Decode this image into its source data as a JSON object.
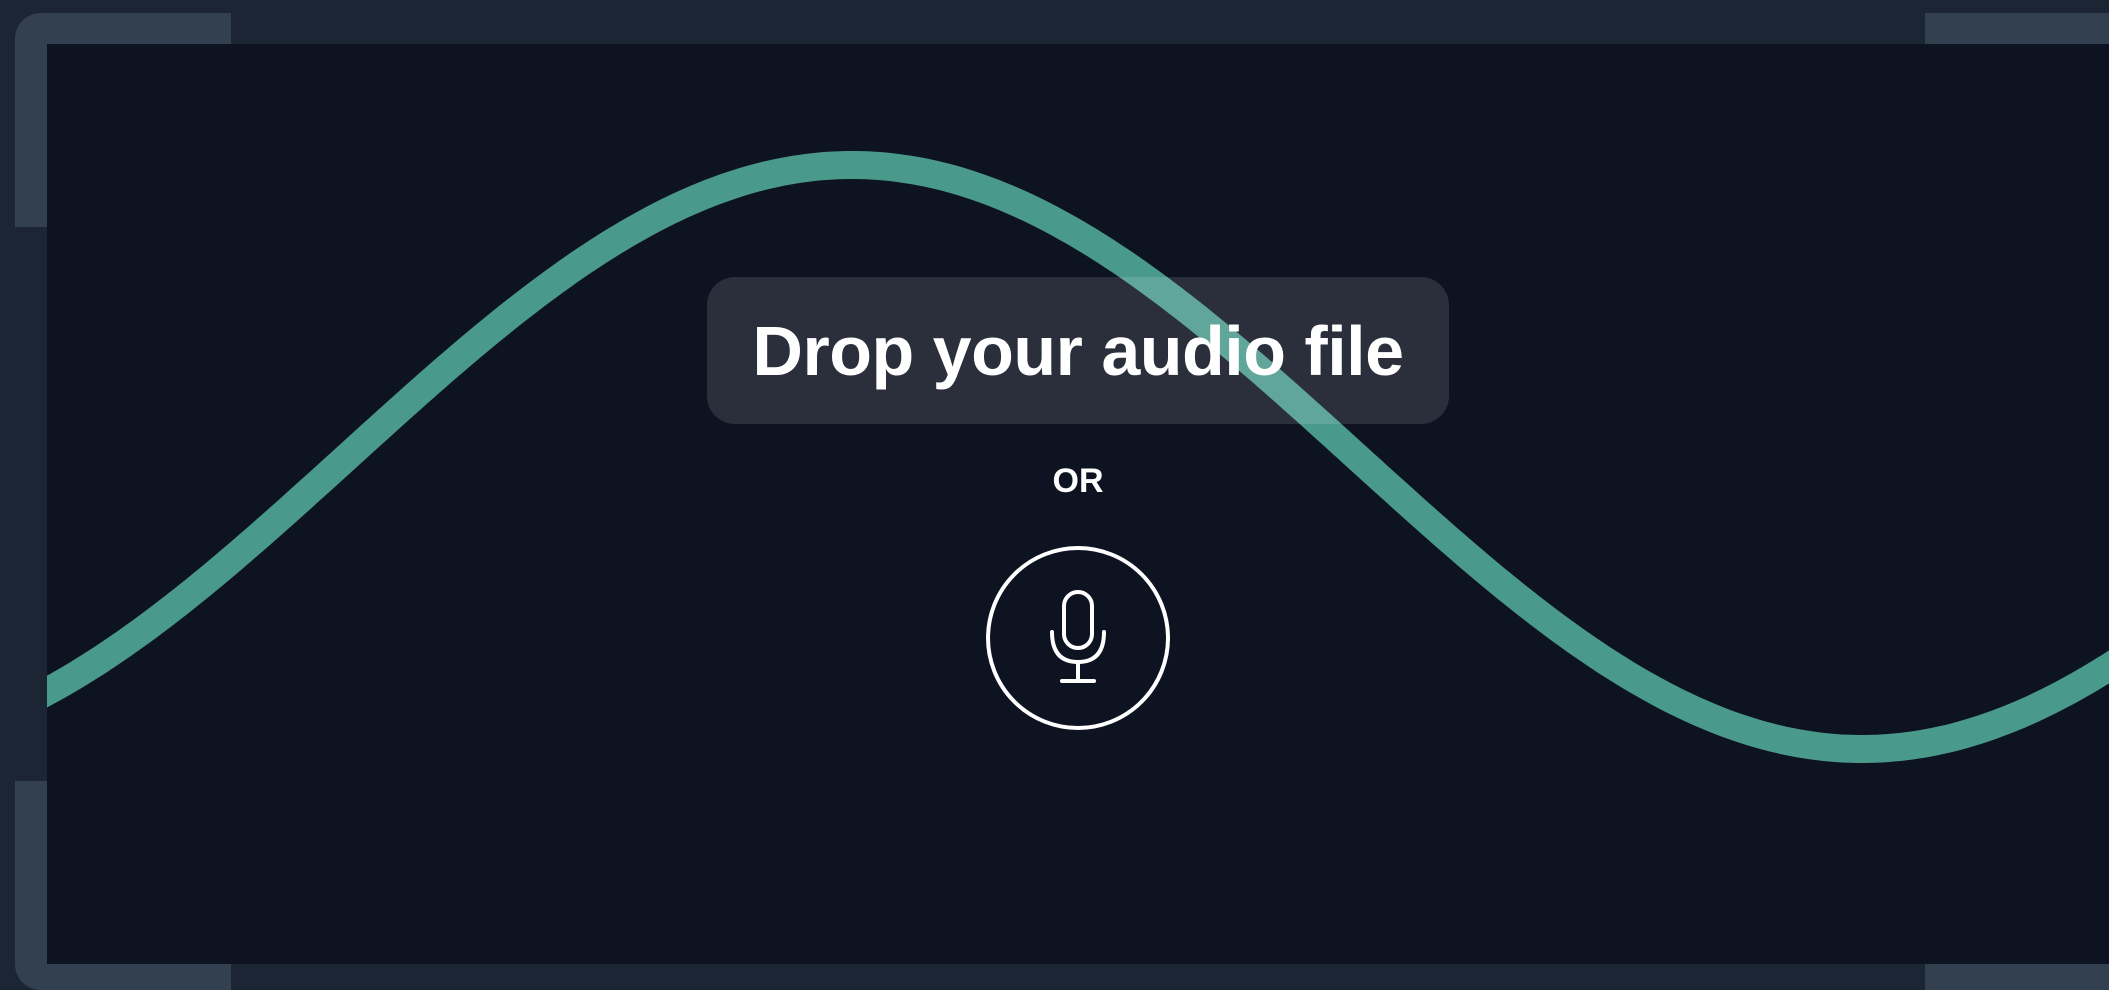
{
  "dropzone": {
    "title": "Drop your audio file",
    "separator": "OR",
    "record_icon": "microphone-icon"
  },
  "colors": {
    "background": "#0e1322",
    "frame": "#1b2533",
    "corner_accent": "#334050",
    "wave": "#4a9a8c",
    "text": "#ffffff"
  }
}
